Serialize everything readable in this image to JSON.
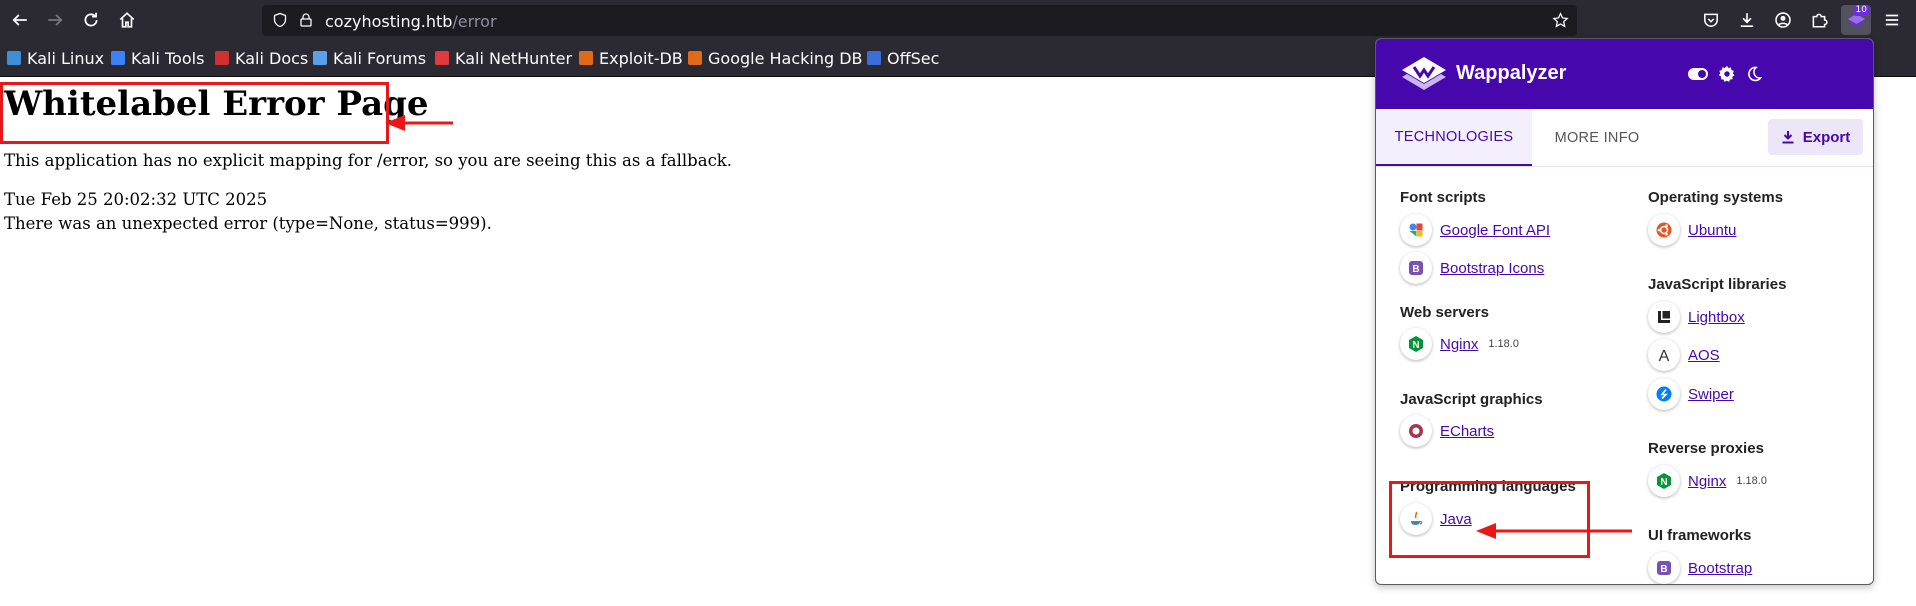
{
  "browser": {
    "url_host": "cozyhosting.htb",
    "url_path": "/error",
    "extension_badge": "10"
  },
  "bookmarks": [
    {
      "label": "Kali Linux",
      "color": "#3f8fd6"
    },
    {
      "label": "Kali Tools",
      "color": "#3b82f6"
    },
    {
      "label": "Kali Docs",
      "color": "#d32f2f"
    },
    {
      "label": "Kali Forums",
      "color": "#5aa0e8"
    },
    {
      "label": "Kali NetHunter",
      "color": "#e03a3a"
    },
    {
      "label": "Exploit-DB",
      "color": "#e06a1a"
    },
    {
      "label": "Google Hacking DB",
      "color": "#e06a1a"
    },
    {
      "label": "OffSec",
      "color": "#3b6fd6"
    }
  ],
  "page": {
    "title": "Whitelabel Error Page",
    "message": "This application has no explicit mapping for /error, so you are seeing this as a fallback.",
    "timestamp": "Tue Feb 25 20:02:32 UTC 2025",
    "error": "There was an unexpected error (type=None, status=999)."
  },
  "wappalyzer": {
    "title": "Wappalyzer",
    "tabs": [
      "TECHNOLOGIES",
      "MORE INFO"
    ],
    "export_label": "Export",
    "left_column": [
      {
        "category": "Font scripts",
        "items": [
          {
            "name": "Google Font API",
            "version": "",
            "icon": "google-font-icon"
          },
          {
            "name": "Bootstrap Icons",
            "version": "",
            "icon": "bootstrap-icon"
          }
        ]
      },
      {
        "category": "Web servers",
        "items": [
          {
            "name": "Nginx",
            "version": "1.18.0",
            "icon": "nginx-icon"
          }
        ]
      },
      {
        "category": "JavaScript graphics",
        "items": [
          {
            "name": "ECharts",
            "version": "",
            "icon": "echarts-icon"
          }
        ]
      },
      {
        "category": "Programming languages",
        "items": [
          {
            "name": "Java",
            "version": "",
            "icon": "java-icon"
          }
        ]
      }
    ],
    "right_column": [
      {
        "category": "Operating systems",
        "items": [
          {
            "name": "Ubuntu",
            "version": "",
            "icon": "ubuntu-icon"
          }
        ]
      },
      {
        "category": "JavaScript libraries",
        "items": [
          {
            "name": "Lightbox",
            "version": "",
            "icon": "lightbox-icon"
          },
          {
            "name": "AOS",
            "version": "",
            "icon": "aos-icon"
          },
          {
            "name": "Swiper",
            "version": "",
            "icon": "swiper-icon"
          }
        ]
      },
      {
        "category": "Reverse proxies",
        "items": [
          {
            "name": "Nginx",
            "version": "1.18.0",
            "icon": "nginx-icon"
          }
        ]
      },
      {
        "category": "UI frameworks",
        "items": [
          {
            "name": "Bootstrap",
            "version": "",
            "icon": "bootstrap-icon"
          }
        ]
      }
    ]
  }
}
